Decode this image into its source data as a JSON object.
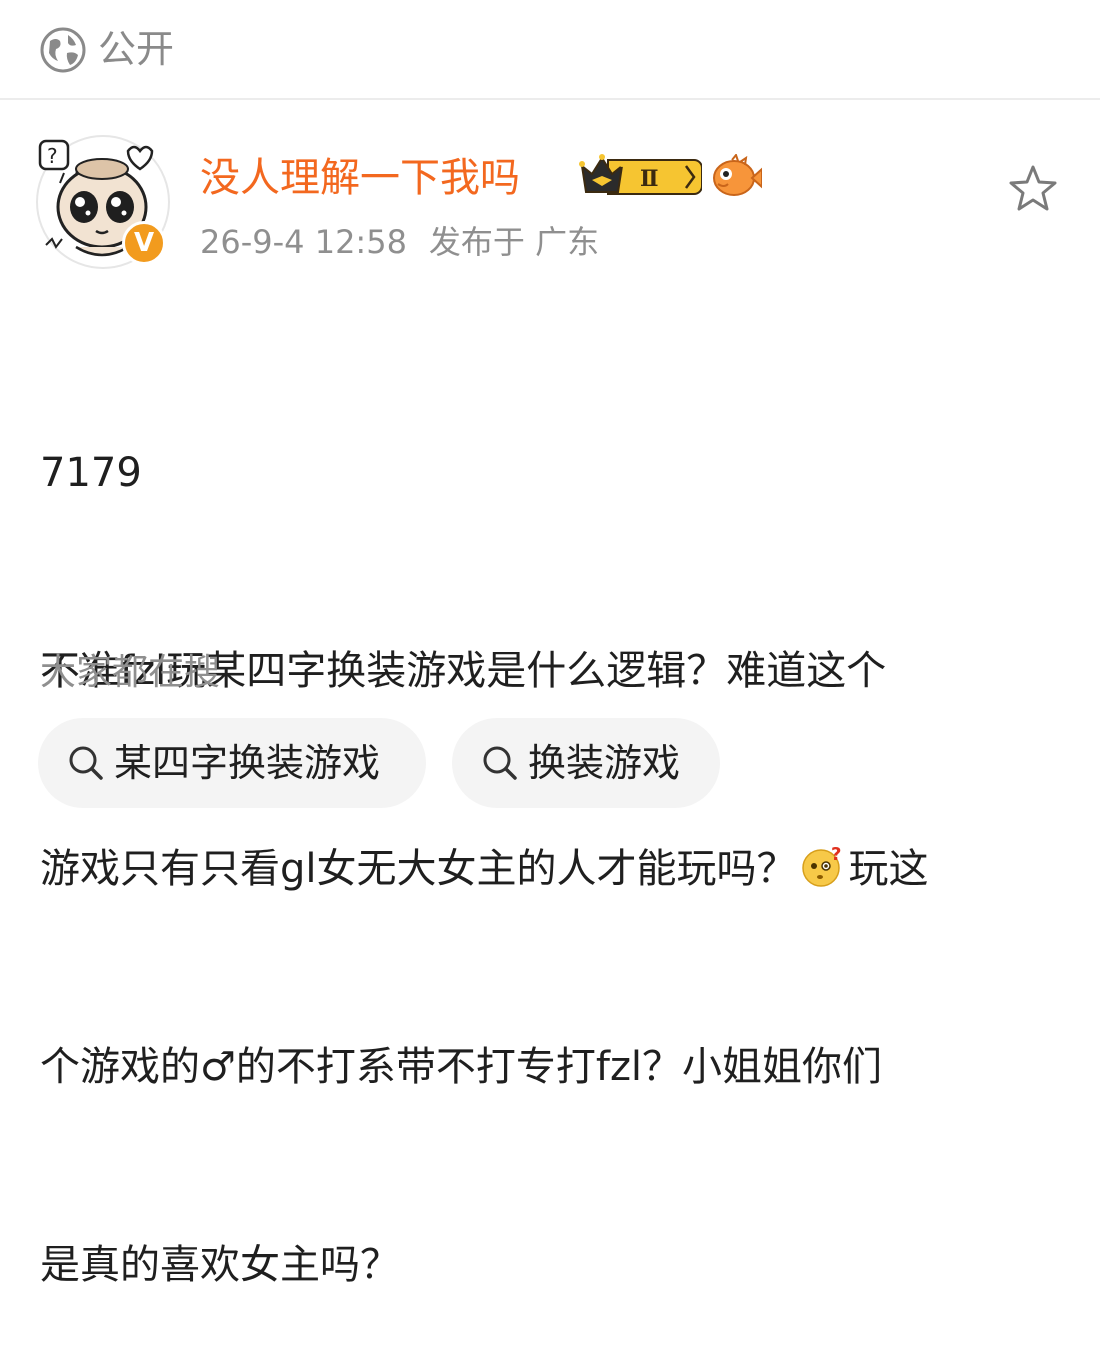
{
  "visibility": {
    "label": "公开",
    "icon": "globe-icon"
  },
  "author": {
    "name": "没人理解一下我吗",
    "badge_text": "Ⅱ",
    "verified_mark": "V"
  },
  "meta": {
    "time": "26-9-4 12:58",
    "location": "发布于 广东"
  },
  "post": {
    "lines": [
      "7179",
      "不准fzl玩某四字换装游戏是什么逻辑？难道这个",
      "游戏只有只看gl女无大女主的人才能玩吗？",
      "玩这",
      "个游戏的♂的不打系带不打专打fzl？小姐姐你们",
      "是真的喜欢女主吗？"
    ]
  },
  "searches": {
    "title": "大家都在搜",
    "items": [
      "某四字换装游戏",
      "换装游戏"
    ]
  },
  "colors": {
    "accent": "#f3681f",
    "muted": "#8f8f8f",
    "chip_bg": "#f4f4f4"
  }
}
